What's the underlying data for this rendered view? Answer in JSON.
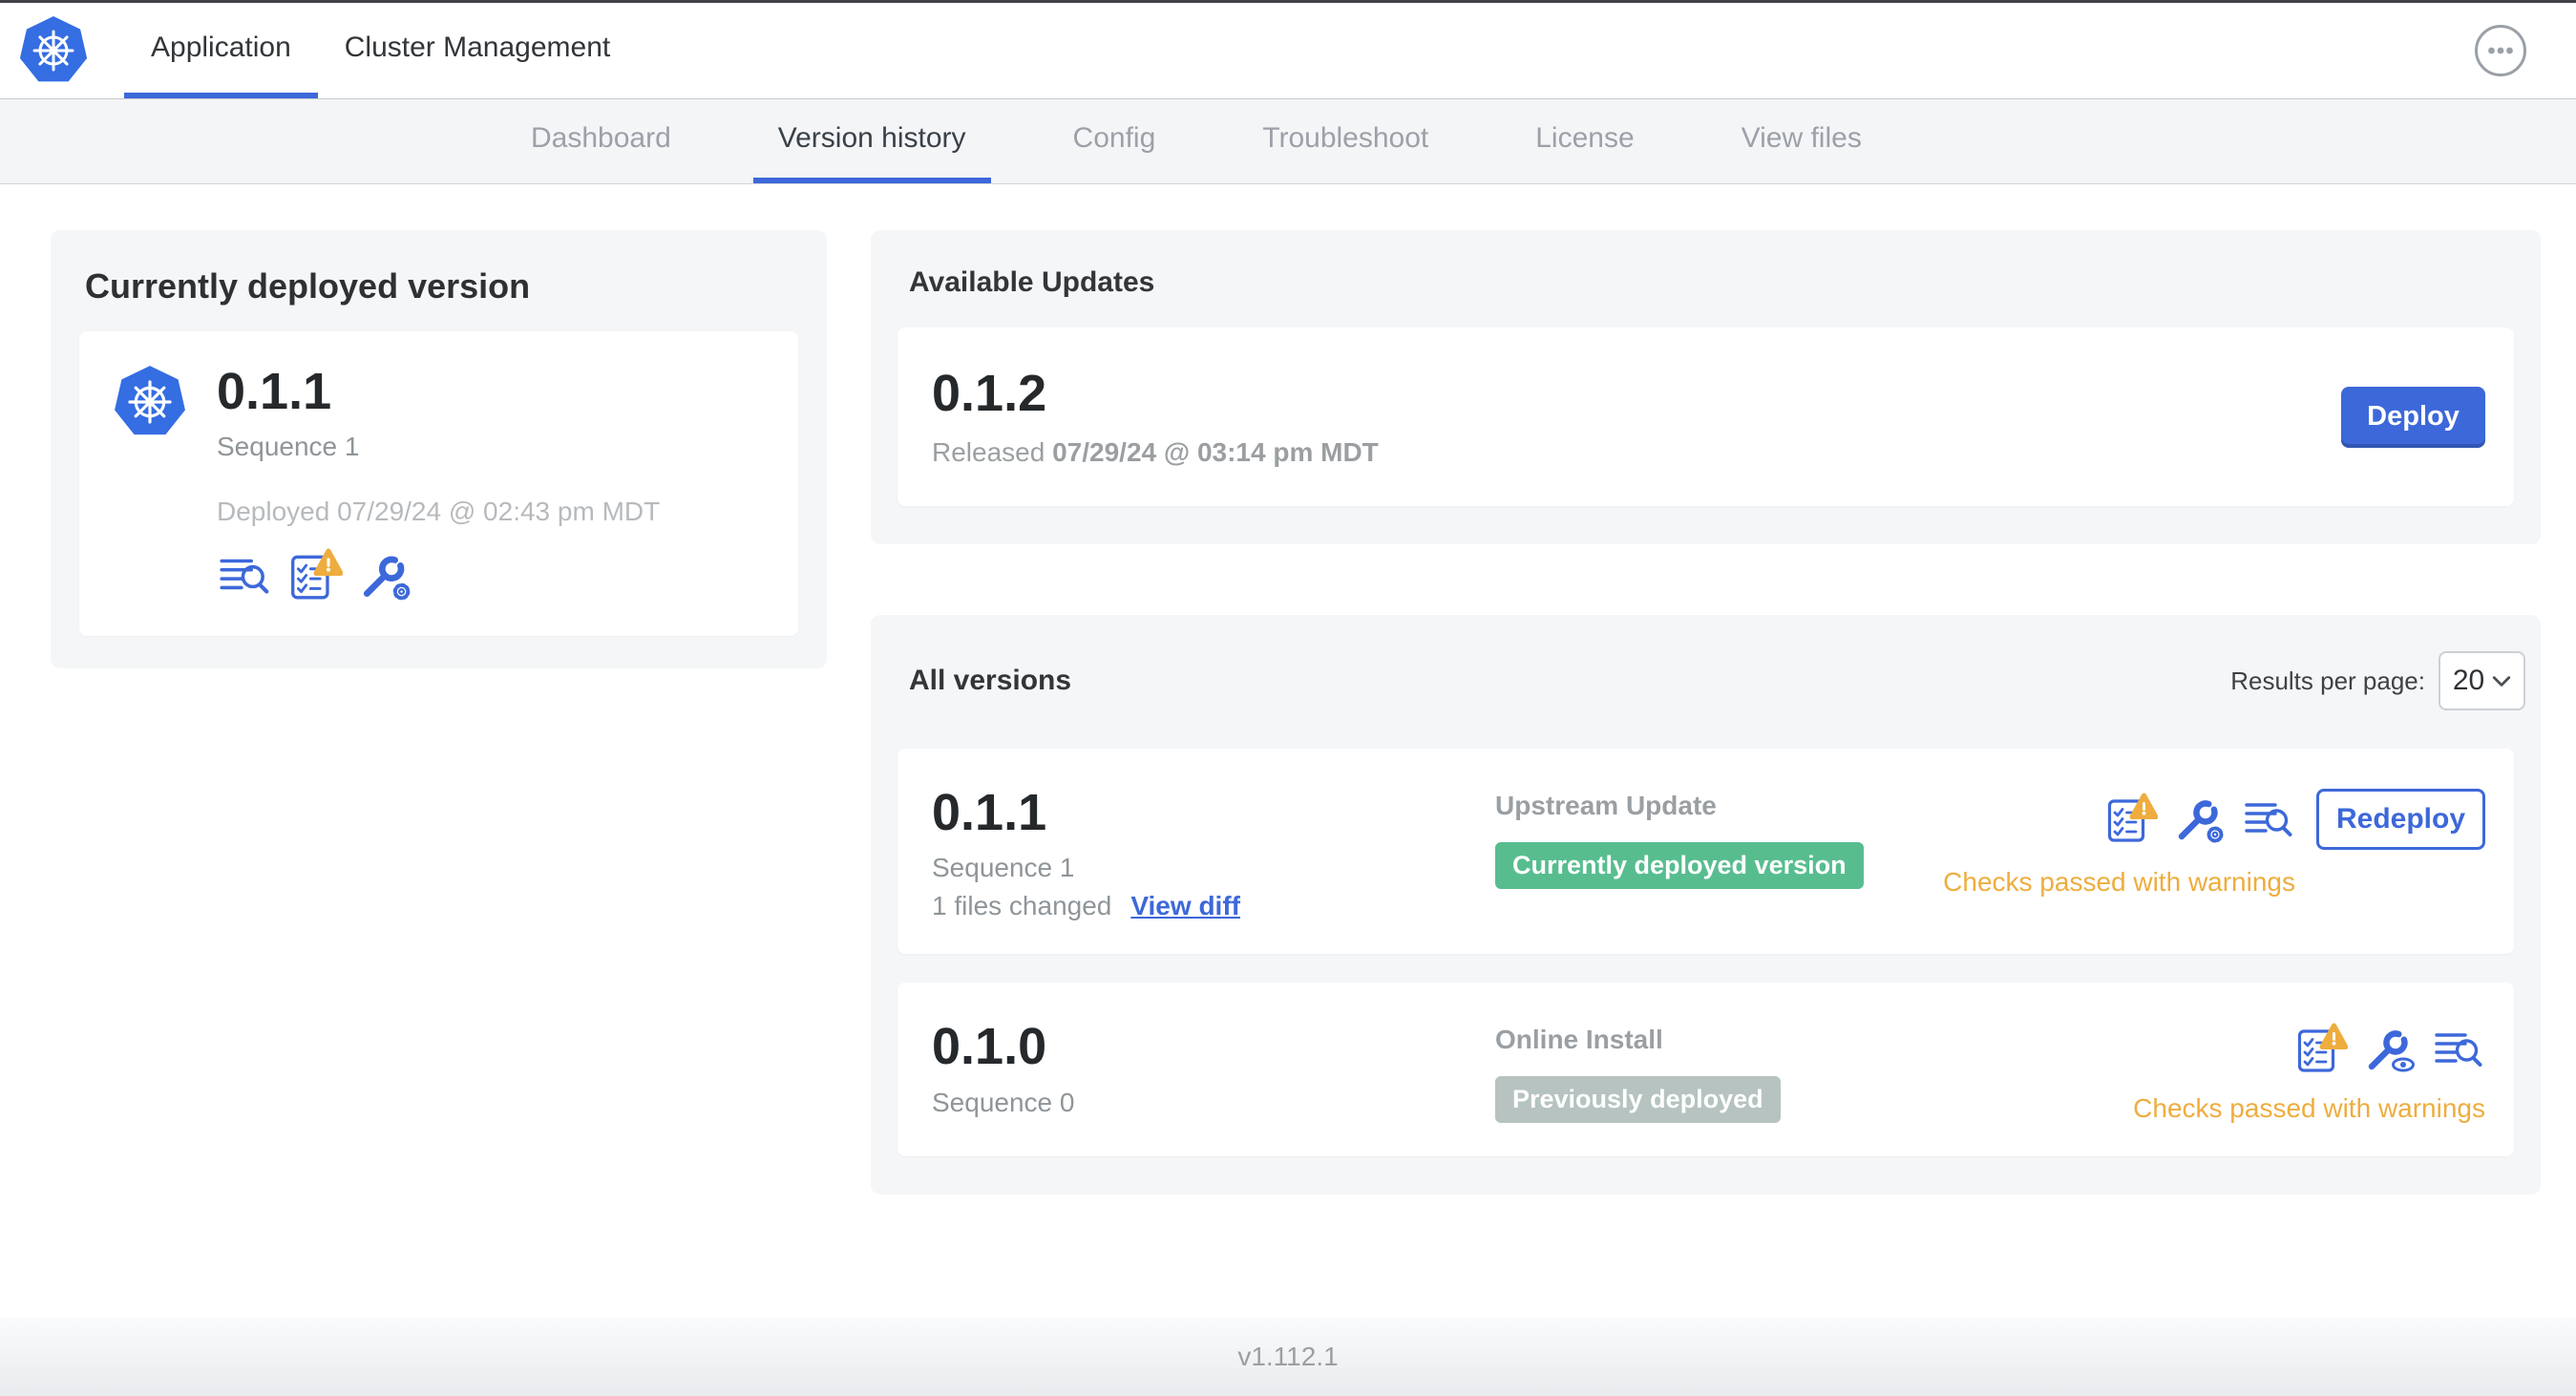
{
  "header": {
    "tabs": [
      {
        "label": "Application",
        "active": true
      },
      {
        "label": "Cluster Management",
        "active": false
      }
    ]
  },
  "subnav": {
    "tabs": [
      {
        "label": "Dashboard",
        "active": false
      },
      {
        "label": "Version history",
        "active": true
      },
      {
        "label": "Config",
        "active": false
      },
      {
        "label": "Troubleshoot",
        "active": false
      },
      {
        "label": "License",
        "active": false
      },
      {
        "label": "View files",
        "active": false
      }
    ]
  },
  "current_version_card": {
    "title": "Currently deployed version",
    "version": "0.1.1",
    "sequence": "Sequence 1",
    "deployed": "Deployed 07/29/24 @ 02:43 pm MDT",
    "icons": [
      "release-notes-icon",
      "preflight-checks-warning-icon",
      "edit-config-icon"
    ]
  },
  "available_updates": {
    "title": "Available Updates",
    "update": {
      "version": "0.1.2",
      "released_label": "Released ",
      "released_date": "07/29/24 @ 03:14 pm MDT",
      "deploy_label": "Deploy"
    }
  },
  "all_versions": {
    "title": "All versions",
    "results_per_page_label": "Results per page:",
    "results_per_page_value": "20",
    "rows": [
      {
        "version": "0.1.1",
        "sequence": "Sequence 1",
        "files_changed": "1 files changed",
        "view_diff_label": "View diff",
        "source": "Upstream Update",
        "badge_label": "Currently deployed version",
        "badge_type": "success",
        "icons": [
          "preflight-checks-warning-icon",
          "edit-config-icon",
          "release-notes-icon"
        ],
        "action_label": "Redeploy",
        "checks": "Checks passed with warnings"
      },
      {
        "version": "0.1.0",
        "sequence": "Sequence 0",
        "source": "Online Install",
        "badge_label": "Previously deployed",
        "badge_type": "muted",
        "icons": [
          "preflight-checks-warning-icon",
          "view-config-icon",
          "release-notes-icon"
        ],
        "checks": "Checks passed with warnings"
      }
    ]
  },
  "footer": {
    "app_version": "v1.112.1"
  },
  "colors": {
    "primary_blue": "#3d68da",
    "logo_blue": "#356de2",
    "success_green": "#57bd8f",
    "muted_badge_gray": "#b6c3c0",
    "warning_orange": "#eead3e"
  }
}
